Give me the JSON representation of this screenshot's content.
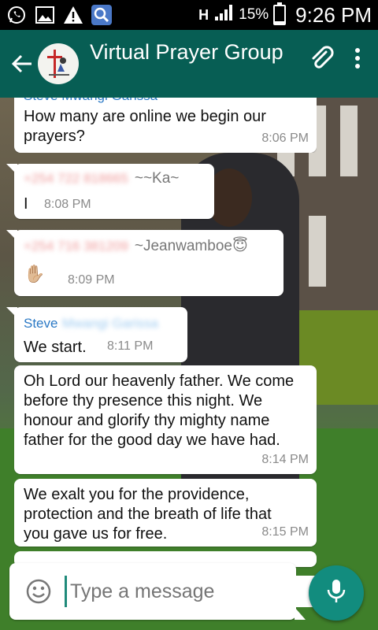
{
  "status_bar": {
    "battery": "15%",
    "time": "9:26 PM",
    "network": "H",
    "battery_level": 0.15
  },
  "header": {
    "title": "Virtual Prayer Group"
  },
  "messages": [
    {
      "sender": "Steve Mwangi Garissa",
      "text": "How many are online we begin our\nprayers?",
      "time": "8:06 PM"
    },
    {
      "sender": "+254 722 818665",
      "nick": "~~Ka~",
      "text": "I",
      "time": "8:08 PM"
    },
    {
      "sender": "+254 716 381209",
      "nick": "~Jeanwamboe😇",
      "text": "✋🏼",
      "time": "8:09 PM"
    },
    {
      "sender": "Steve",
      "sender_blurred": "Mwangi Garissa",
      "text": "We start.",
      "time": "8:11 PM"
    },
    {
      "text": "Oh Lord our heavenly father. We come\nbefore thy presence this night. We\nhonour and glorify thy mighty name\nfather for the good day we have had.",
      "time": "8:14 PM"
    },
    {
      "text": "We exalt you for the providence,\nprotection and the breath of life that\nyou gave us for free.",
      "time": "8:15 PM"
    }
  ],
  "composer": {
    "placeholder": "Type a message"
  },
  "colors": {
    "app_bar": "#075e54",
    "accent": "#128c7e",
    "sender_blue": "#2b79c5"
  }
}
